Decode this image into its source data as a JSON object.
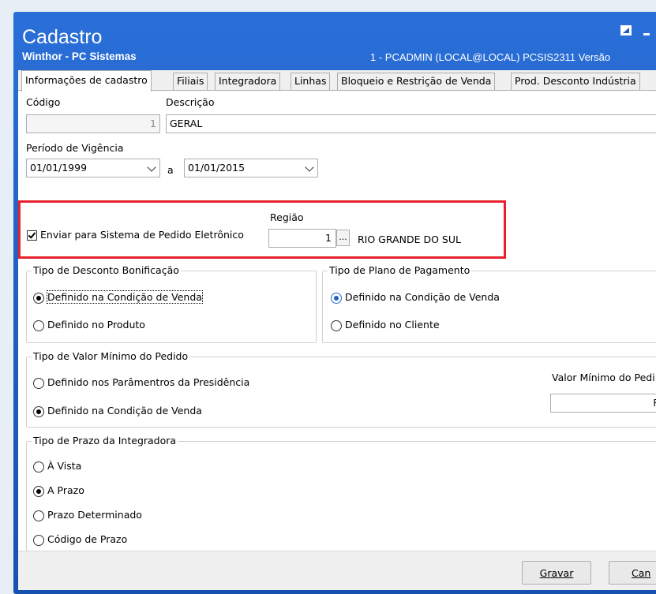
{
  "window": {
    "title": "Cadastro",
    "subtitle": "Winthor - PC Sistemas",
    "info": "1 - PCADMIN (LOCAL@LOCAL)  PCSIS2311  Versão"
  },
  "tabs": [
    {
      "label": "Informações de cadastro",
      "active": true
    },
    {
      "label": "Filiais"
    },
    {
      "label": "Integradora"
    },
    {
      "label": "Linhas"
    },
    {
      "label": "Bloqueio e Restrição de Venda"
    },
    {
      "label": "Prod. Desconto Indústria"
    }
  ],
  "form": {
    "codigo_label": "Código",
    "codigo_value": "1",
    "descricao_label": "Descrição",
    "descricao_value": "GERAL",
    "periodo_label": "Período de Vigência",
    "data_inicio": "01/01/1999",
    "periodo_sep": "a",
    "data_fim": "01/01/2015",
    "enviar_label": "Enviar para Sistema de Pedido Eletrônico",
    "enviar_checked": true,
    "regiao_label": "Região",
    "regiao_codigo": "1",
    "regiao_btn": "...",
    "regiao_nome": "RIO GRANDE DO SUL"
  },
  "groups": {
    "desconto": {
      "title": "Tipo de Desconto Bonificação",
      "options": [
        "Definido na Condição de Venda",
        "Definido no Produto"
      ],
      "selected": 0
    },
    "plano": {
      "title": "Tipo de Plano de Pagamento",
      "options": [
        "Definido na Condição de Venda",
        "Definido no Cliente"
      ],
      "selected": 0
    },
    "valor_minimo": {
      "title": "Tipo de Valor Mínimo do Pedido",
      "options": [
        "Definido nos Parâmentros da Presidência",
        "Definido na Condição  de Venda"
      ],
      "selected": 1,
      "valor_label": "Valor Mínimo do Pedi",
      "valor_value": "R$"
    },
    "prazo": {
      "title": "Tipo de Prazo da Integradora",
      "options": [
        "À Vista",
        "A Prazo",
        "Prazo Determinado",
        "Código de Prazo"
      ],
      "selected": 1
    }
  },
  "buttons": {
    "gravar": "Gravar",
    "cancelar": "Can"
  },
  "colors": {
    "titlebar": "#1d5cc0",
    "highlight": "#e8212c"
  }
}
